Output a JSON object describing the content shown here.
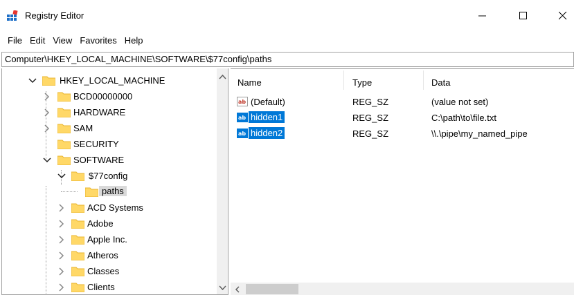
{
  "window": {
    "title": "Registry Editor"
  },
  "menu": [
    "File",
    "Edit",
    "View",
    "Favorites",
    "Help"
  ],
  "address": "Computer\\HKEY_LOCAL_MACHINE\\SOFTWARE\\$77config\\paths",
  "tree": {
    "items": [
      {
        "label": "HKEY_LOCAL_MACHINE",
        "expanded": true
      },
      {
        "label": "BCD00000000"
      },
      {
        "label": "HARDWARE"
      },
      {
        "label": "SAM"
      },
      {
        "label": "SECURITY"
      },
      {
        "label": "SOFTWARE",
        "expanded": true
      },
      {
        "label": "$77config",
        "expanded": true
      },
      {
        "label": "paths",
        "selected": true
      },
      {
        "label": "ACD Systems"
      },
      {
        "label": "Adobe"
      },
      {
        "label": "Apple Inc."
      },
      {
        "label": "Atheros"
      },
      {
        "label": "Classes"
      },
      {
        "label": "Clients"
      }
    ]
  },
  "list": {
    "columns": [
      "Name",
      "Type",
      "Data"
    ],
    "rows": [
      {
        "name": "(Default)",
        "type": "REG_SZ",
        "data": "(value not set)",
        "selected": false
      },
      {
        "name": "hidden1",
        "type": "REG_SZ",
        "data": "C:\\path\\to\\file.txt",
        "selected": true
      },
      {
        "name": "hidden2",
        "type": "REG_SZ",
        "data": "\\\\.\\pipe\\my_named_pipe",
        "selected": true
      }
    ]
  },
  "colors": {
    "selection": "#0078d7",
    "folder": "#ffd867",
    "folder_edge": "#e8b52f"
  }
}
